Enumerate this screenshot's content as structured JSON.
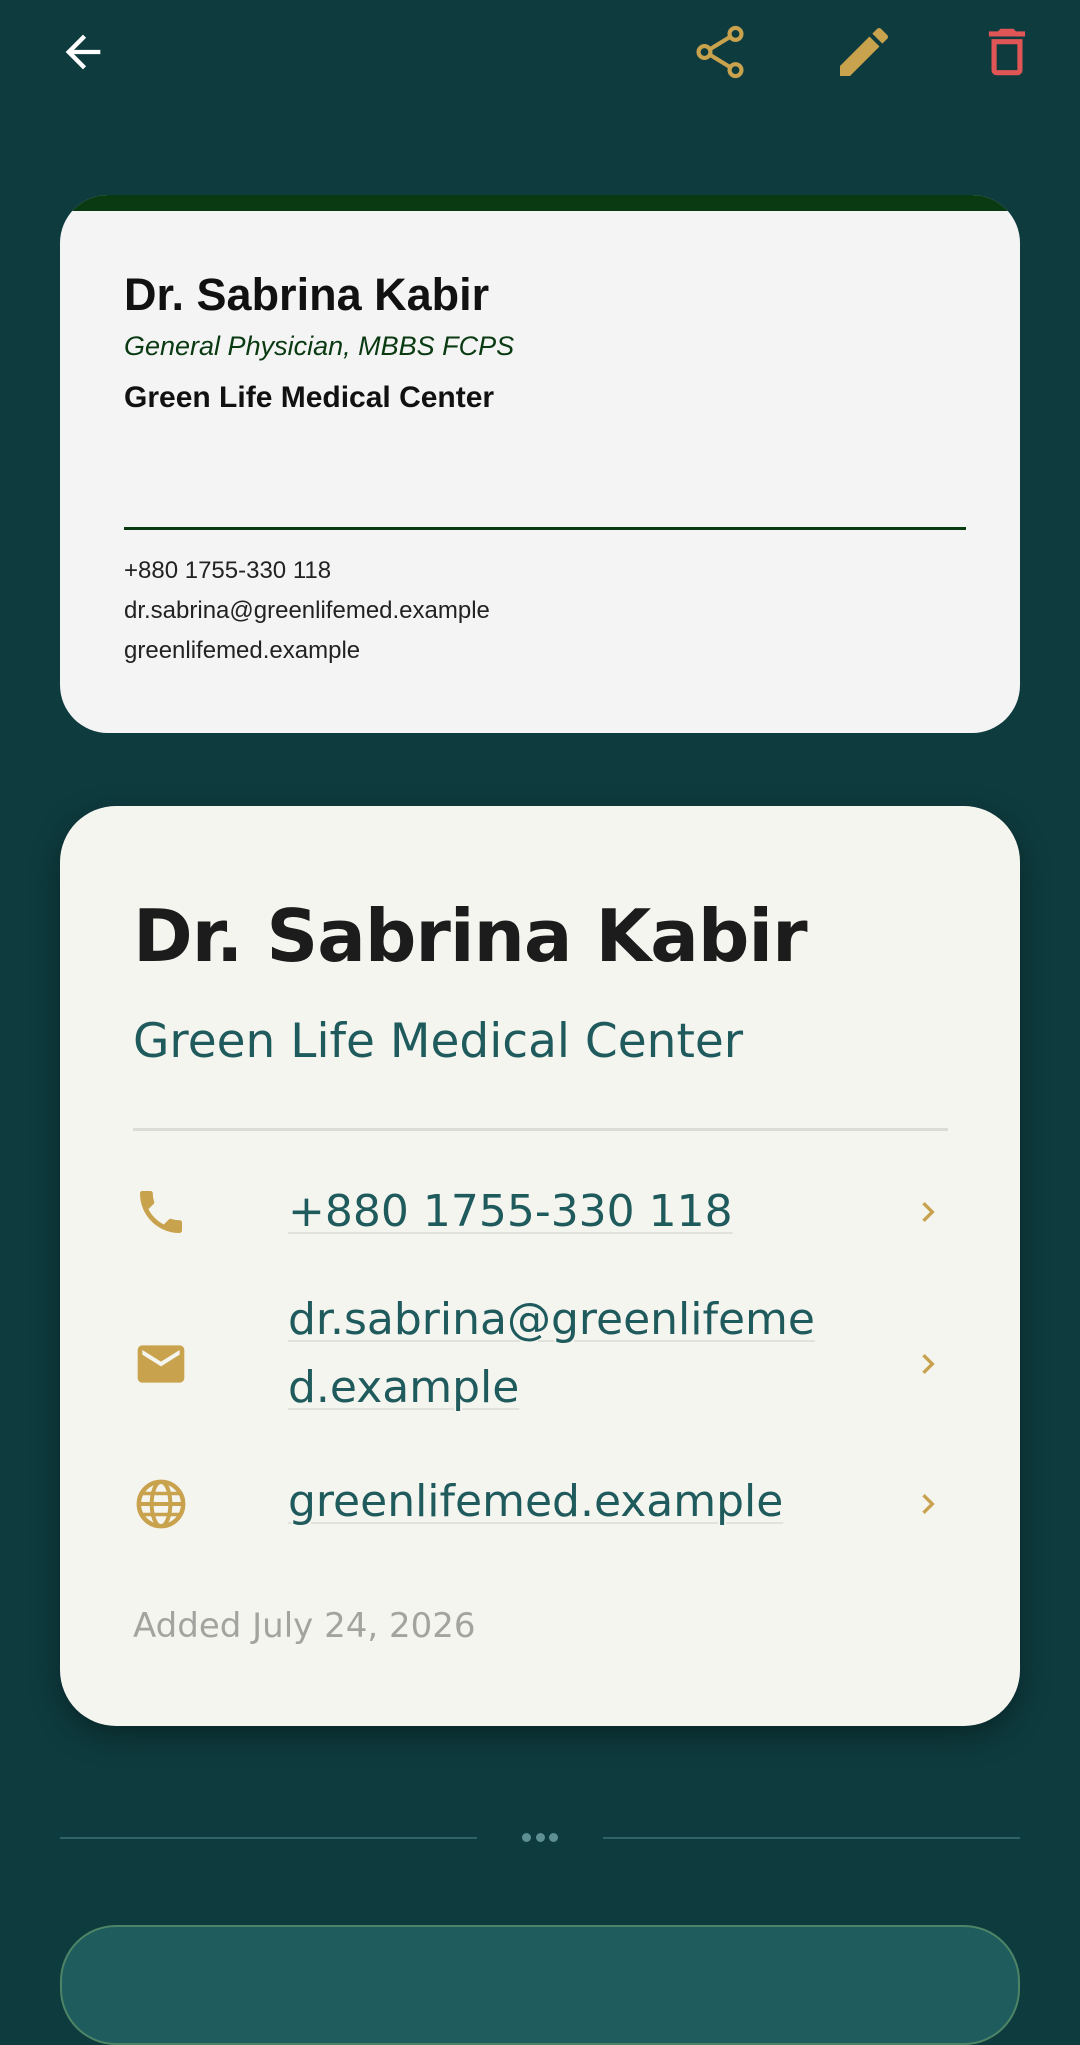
{
  "colors": {
    "background": "#0e3b3e",
    "accent_gold": "#c9a24d",
    "delete_red": "#e05555",
    "teal_text": "#1f5a5c",
    "card_dark_green": "#0a3a12"
  },
  "toolbar": {
    "back_icon": "arrow-left-icon",
    "share_icon": "share-icon",
    "edit_icon": "pencil-icon",
    "delete_icon": "trash-icon"
  },
  "card_preview": {
    "name": "Dr. Sabrina Kabir",
    "title": "General Physician, MBBS FCPS",
    "organization": "Green Life Medical Center",
    "phone": "+880 1755-330 118",
    "email": "dr.sabrina@greenlifemed.example",
    "website": "greenlifemed.example"
  },
  "details": {
    "name": "Dr. Sabrina Kabir",
    "organization": "Green Life Medical Center",
    "rows": [
      {
        "icon": "phone-icon",
        "value": "+880 1755-330 118"
      },
      {
        "icon": "email-icon",
        "value": "dr.sabrina@greenlifemed.example"
      },
      {
        "icon": "globe-icon",
        "value": "greenlifemed.example"
      }
    ],
    "added": "Added July 24, 2026"
  }
}
